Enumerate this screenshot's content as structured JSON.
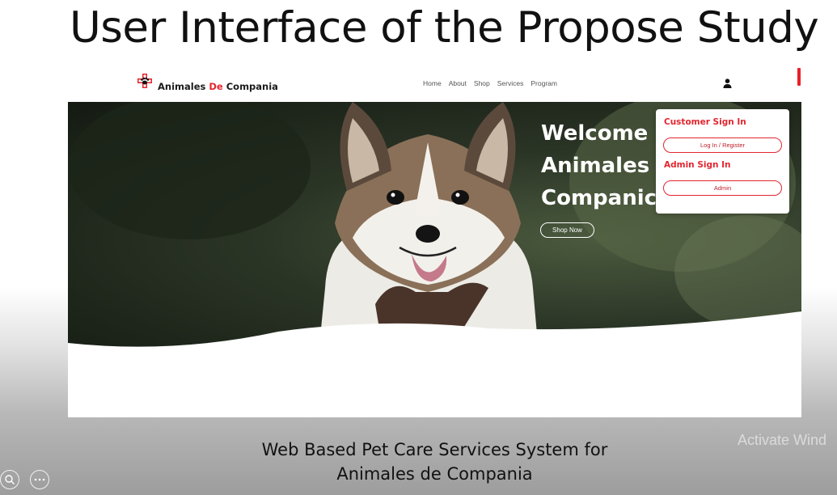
{
  "slide": {
    "title": "User Interface of the Propose Study",
    "caption_line1": "Web Based Pet Care Services System for",
    "caption_line2": "Animales de Compania"
  },
  "site": {
    "brand": {
      "part1": "Animales ",
      "part2": "De",
      "part3": " Compania"
    },
    "nav": [
      "Home",
      "About",
      "Shop",
      "Services",
      "Program"
    ],
    "hero": {
      "line1": "Welcome",
      "line2": "Animales",
      "line3": "Companic",
      "cta": "Shop Now"
    },
    "signin": {
      "customer_heading": "Customer Sign In",
      "customer_button": "Log In / Register",
      "admin_heading": "Admin Sign In",
      "admin_button": "Admin"
    }
  },
  "overlay": {
    "watermark": "Activate Wind"
  },
  "colors": {
    "accent": "#e3262f",
    "text": "#1b1b1b",
    "hero_dark": "#1e261b"
  },
  "icons": [
    "cross-paw-logo-icon",
    "user-icon",
    "zoom-icon",
    "more-options-icon"
  ]
}
